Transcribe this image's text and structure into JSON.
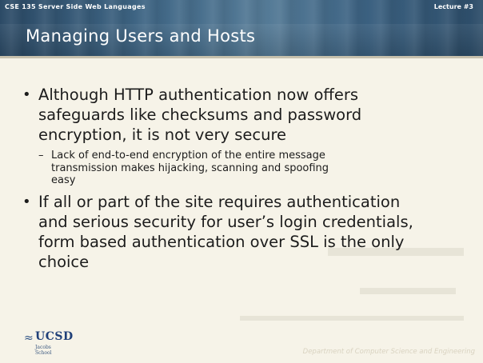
{
  "header": {
    "course": "CSE 135   Server Side Web Languages",
    "lecture": "Lecture #3",
    "title": "Managing Users and Hosts"
  },
  "bullets": [
    {
      "lines": [
        "Although HTTP authentication now offers",
        "safeguards like checksums and password",
        "encryption, it is not very secure"
      ],
      "sub": [
        {
          "lines": [
            "Lack of end-to-end encryption of the entire message",
            "transmission makes hijacking, scanning and spoofing",
            "easy"
          ]
        }
      ]
    },
    {
      "lines": [
        "If all or part of the site requires authentication",
        "and serious security for user’s login credentials,",
        "form based authentication over SSL is the only",
        "choice"
      ],
      "sub": []
    }
  ],
  "logo": {
    "text": "UCSD",
    "subtext": "Jacobs School"
  },
  "footer": {
    "department": "Department of Computer Science and Engineering"
  }
}
